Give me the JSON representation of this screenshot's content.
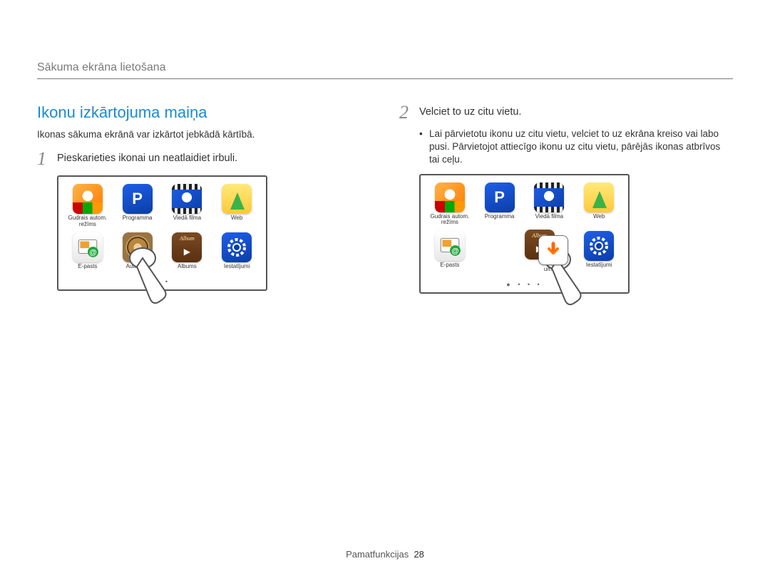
{
  "chapter": "Sākuma ekrāna lietošana",
  "section_title": "Ikonu izkārtojuma maiņa",
  "intro": "Ikonas sākuma ekrānā var izkārtot jebkādā kārtībā.",
  "step1": {
    "num": "1",
    "text": "Pieskarieties ikonai un neatlaidiet irbuli."
  },
  "step2": {
    "num": "2",
    "text": "Velciet to uz citu vietu.",
    "bullet": "Lai pārvietotu ikonu uz citu vietu, velciet to uz ekrāna kreiso vai labo pusi. Pārvietojot attiecīgo ikonu uz citu vietu, pārējās ikonas atbrīvos tai ceļu."
  },
  "apps": {
    "smart_auto": "Gudrais autom.\nrežīms",
    "program": "Programma",
    "movie": "Viedā filma",
    "web": "Web",
    "email": "E-pasts",
    "backup": "Autom. d",
    "album": "Albums",
    "settings": "Iestatījumi",
    "album_partial": "ums"
  },
  "pager1": "● •",
  "pager2": "● • • •",
  "footer": {
    "label": "Pamatfunkcijas",
    "page": "28"
  }
}
